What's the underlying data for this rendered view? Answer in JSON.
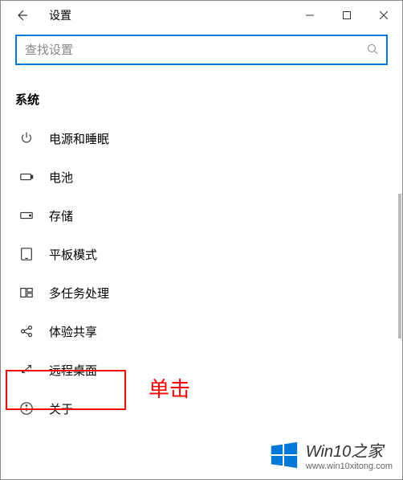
{
  "titlebar": {
    "title": "设置"
  },
  "search": {
    "placeholder": "查找设置"
  },
  "category": {
    "label": "系统"
  },
  "menu": {
    "items": [
      {
        "label": "电源和睡眠"
      },
      {
        "label": "电池"
      },
      {
        "label": "存储"
      },
      {
        "label": "平板模式"
      },
      {
        "label": "多任务处理"
      },
      {
        "label": "体验共享"
      },
      {
        "label": "远程桌面"
      },
      {
        "label": "关于"
      }
    ]
  },
  "annotation": {
    "text": "单击"
  },
  "watermark": {
    "title": "Win10之家",
    "url": "www.win10xitong.com"
  }
}
